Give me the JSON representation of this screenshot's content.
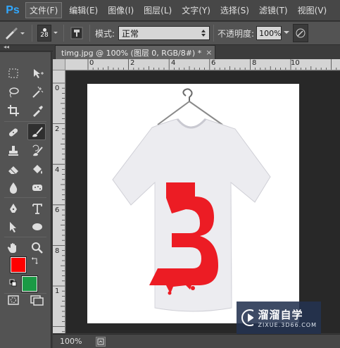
{
  "app": {
    "logo": "Ps"
  },
  "menu": [
    {
      "label": "文件(F)",
      "active": true
    },
    {
      "label": "编辑(E)"
    },
    {
      "label": "图像(I)"
    },
    {
      "label": "图层(L)"
    },
    {
      "label": "文字(Y)"
    },
    {
      "label": "选择(S)"
    },
    {
      "label": "滤镜(T)"
    },
    {
      "label": "视图(V)"
    }
  ],
  "options": {
    "brush_size": "28",
    "mode_label": "模式:",
    "mode_value": "正常",
    "opacity_label": "不透明度:",
    "opacity_value": "100%"
  },
  "panel_collapse": "◂◂",
  "document": {
    "tab_title": "timg.jpg @ 100% (图层 0, RGB/8#) *",
    "close_glyph": "×",
    "ruler_top_labels": [
      "0",
      "2",
      "4",
      "6",
      "8",
      "10"
    ],
    "ruler_left_labels": [
      "0",
      "2",
      "4",
      "6",
      "8",
      "1"
    ]
  },
  "status": {
    "zoom": "100%"
  },
  "colors": {
    "foreground": "#ff0000",
    "background": "#1a9a45",
    "accent": "#31a8ff"
  },
  "watermark": {
    "title": "溜溜自学",
    "url": "ZIXUE.3D66.COM"
  },
  "tools": [
    "marquee-icon",
    "move-icon",
    "lasso-icon",
    "magic-wand-icon",
    "crop-icon",
    "eyedropper-icon",
    "healing-icon",
    "brush-icon",
    "stamp-icon",
    "history-brush-icon",
    "eraser-icon",
    "bucket-icon",
    "blur-icon",
    "sponge-icon",
    "pen-icon",
    "type-icon",
    "path-select-icon",
    "ellipse-icon",
    "hand-icon",
    "zoom-icon"
  ]
}
